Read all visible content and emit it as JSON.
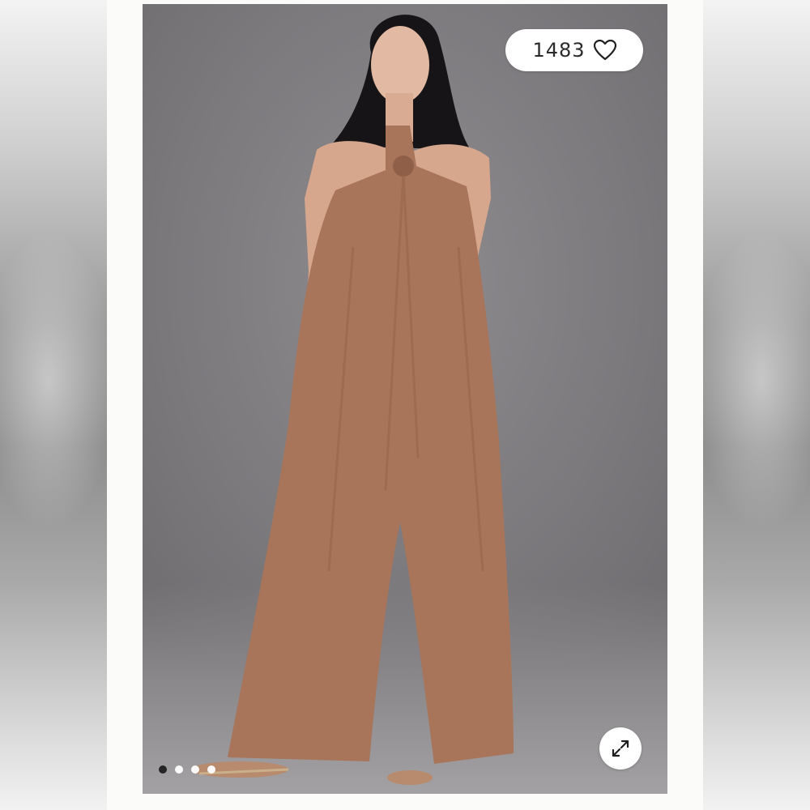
{
  "listing": {
    "likes_count": "1483",
    "carousel": {
      "total_images": 4,
      "active_index": 0
    }
  },
  "icons": {
    "like": "heart-icon",
    "expand": "expand-icon"
  },
  "colors": {
    "card_background": "#fbfbf9",
    "photo_background": "#7b797c",
    "garment": "#a9755a",
    "pill_background": "#ffffff",
    "dot_active": "#1f1f1f",
    "dot_inactive": "#ffffff"
  }
}
